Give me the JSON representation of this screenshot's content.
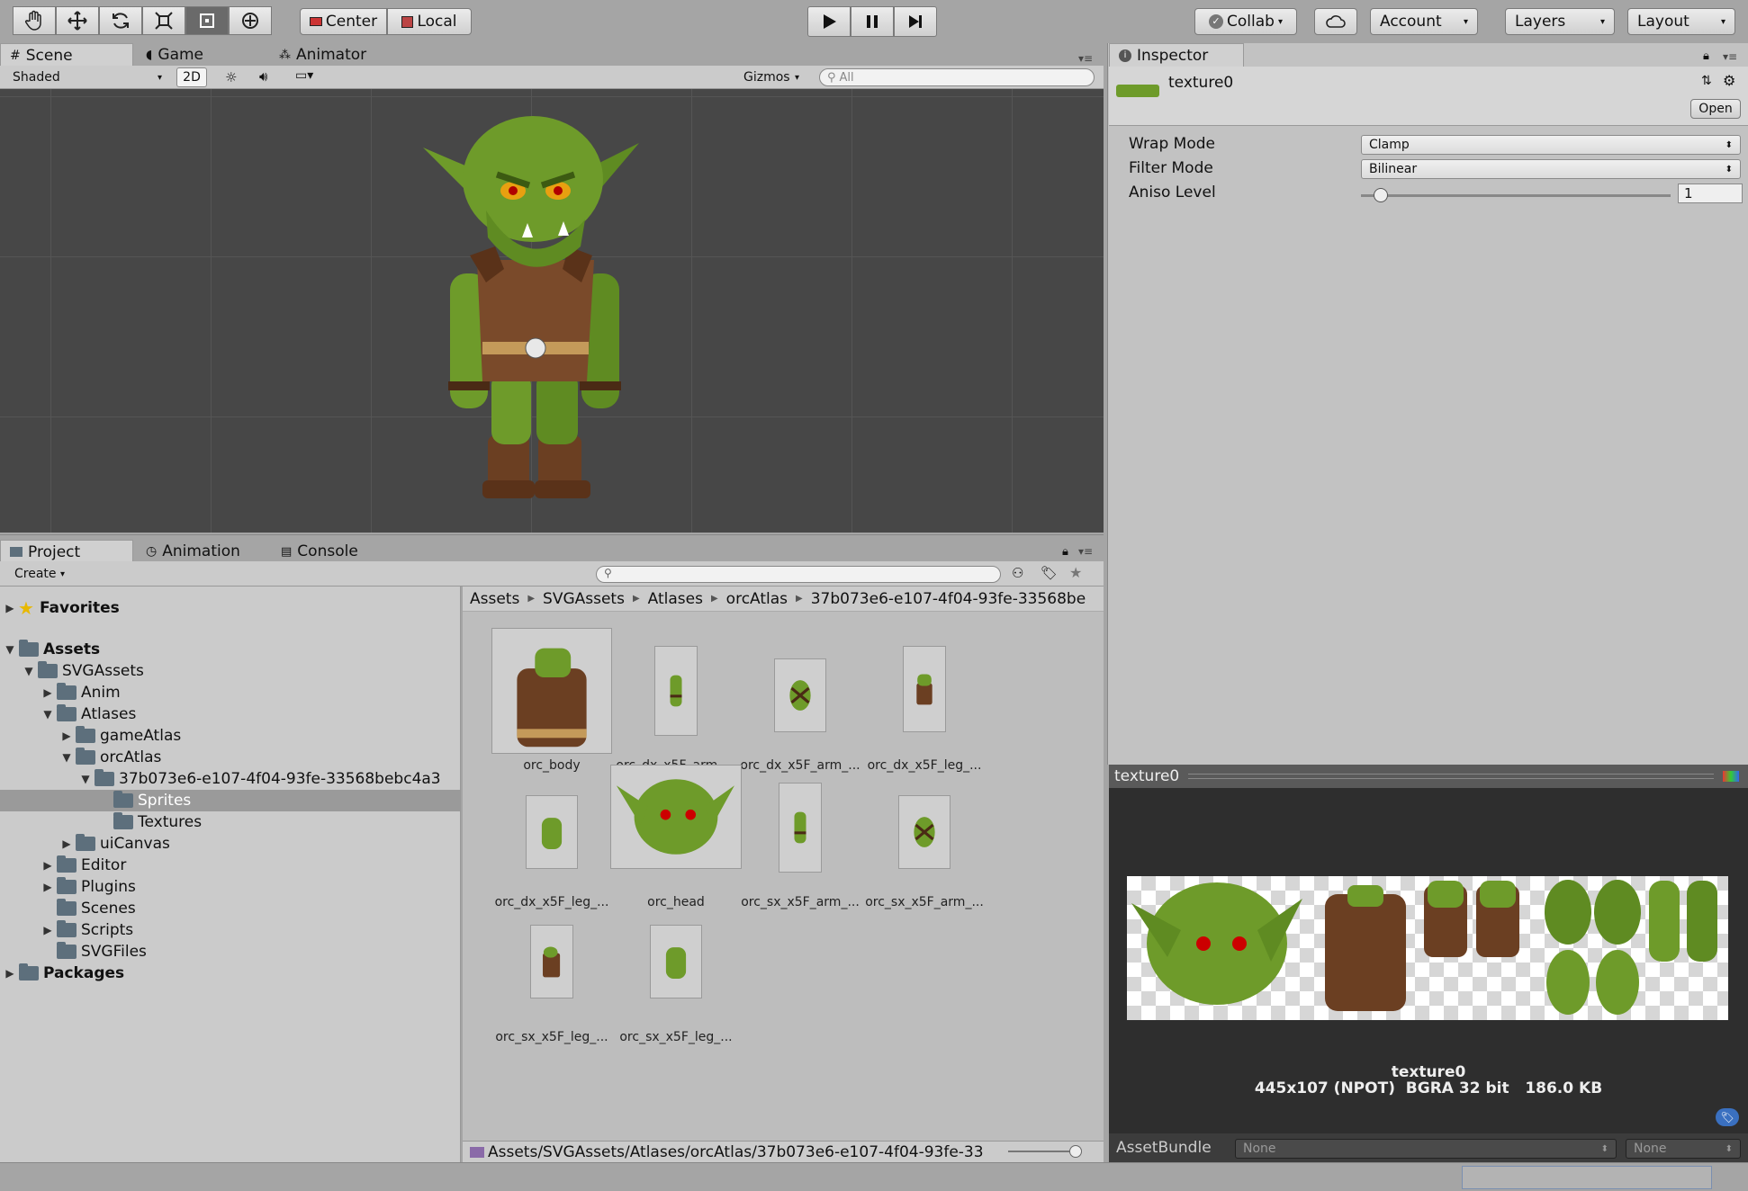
{
  "toolbar": {
    "tools": [
      "hand-icon",
      "move-icon",
      "rotate-icon",
      "scale-icon",
      "rect-icon",
      "transform-icon"
    ],
    "pivot": "Center",
    "space": "Local",
    "collab": "Collab",
    "account": "Account",
    "layers": "Layers",
    "layout": "Layout"
  },
  "scene": {
    "tabs": [
      "Scene",
      "Game",
      "Animator"
    ],
    "shading": "Shaded",
    "mode_2d": "2D",
    "gizmos": "Gizmos",
    "search_placeholder": "All"
  },
  "inspector": {
    "tab": "Inspector",
    "asset_name": "texture0",
    "open_button": "Open",
    "fields": [
      {
        "label": "Wrap Mode",
        "value": "Clamp"
      },
      {
        "label": "Filter Mode",
        "value": "Bilinear"
      },
      {
        "label": "Aniso Level",
        "value": "1"
      }
    ],
    "aniso_slider_fraction": 0.0
  },
  "preview": {
    "title": "texture0",
    "name": "texture0",
    "info": "445x107 (NPOT)  BGRA 32 bit   186.0 KB",
    "assetbundle_label": "AssetBundle",
    "assetbundle_value": "None",
    "assetbundle_variant": "None"
  },
  "project": {
    "tabs": [
      "Project",
      "Animation",
      "Console"
    ],
    "create": "Create",
    "tree": [
      {
        "label": "Favorites",
        "bold": true,
        "depth": 0,
        "arrow": "▶",
        "icon": "star"
      },
      {
        "label": "Assets",
        "bold": true,
        "depth": 0,
        "arrow": "▼",
        "icon": "folder"
      },
      {
        "label": "SVGAssets",
        "depth": 1,
        "arrow": "▼",
        "icon": "folder"
      },
      {
        "label": "Anim",
        "depth": 2,
        "arrow": "▶",
        "icon": "folder"
      },
      {
        "label": "Atlases",
        "depth": 2,
        "arrow": "▼",
        "icon": "folder"
      },
      {
        "label": "gameAtlas",
        "depth": 3,
        "arrow": "▶",
        "icon": "folder"
      },
      {
        "label": "orcAtlas",
        "depth": 3,
        "arrow": "▼",
        "icon": "folder"
      },
      {
        "label": "37b073e6-e107-4f04-93fe-33568bebc4a3",
        "depth": 4,
        "arrow": "▼",
        "icon": "folder"
      },
      {
        "label": "Sprites",
        "depth": 5,
        "arrow": "",
        "icon": "folder",
        "selected": true
      },
      {
        "label": "Textures",
        "depth": 5,
        "arrow": "",
        "icon": "folder"
      },
      {
        "label": "uiCanvas",
        "depth": 3,
        "arrow": "▶",
        "icon": "folder"
      },
      {
        "label": "Editor",
        "depth": 2,
        "arrow": "▶",
        "icon": "folder"
      },
      {
        "label": "Plugins",
        "depth": 2,
        "arrow": "▶",
        "icon": "folder"
      },
      {
        "label": "Scenes",
        "depth": 2,
        "arrow": "",
        "icon": "folder"
      },
      {
        "label": "Scripts",
        "depth": 2,
        "arrow": "▶",
        "icon": "folder"
      },
      {
        "label": "SVGFiles",
        "depth": 2,
        "arrow": "",
        "icon": "folder"
      },
      {
        "label": "Packages",
        "bold": true,
        "depth": 0,
        "arrow": "▶",
        "icon": "folder"
      }
    ],
    "breadcrumb": [
      "Assets",
      "SVGAssets",
      "Atlases",
      "orcAtlas",
      "37b073e6-e107-4f04-93fe-33568be"
    ],
    "assets": [
      {
        "name": "orc_body",
        "kind": "body"
      },
      {
        "name": "orc_dx_x5F_arm_...",
        "kind": "arm"
      },
      {
        "name": "orc_dx_x5F_arm_...",
        "kind": "arm2"
      },
      {
        "name": "orc_dx_x5F_leg_...",
        "kind": "leg"
      },
      {
        "name": "orc_dx_x5F_leg_...",
        "kind": "thigh"
      },
      {
        "name": "orc_head",
        "kind": "head"
      },
      {
        "name": "orc_sx_x5F_arm_...",
        "kind": "arm"
      },
      {
        "name": "orc_sx_x5F_arm_...",
        "kind": "arm2"
      },
      {
        "name": "orc_sx_x5F_leg_...",
        "kind": "boot"
      },
      {
        "name": "orc_sx_x5F_leg_...",
        "kind": "thigh"
      }
    ],
    "path": "Assets/SVGAssets/Atlases/orcAtlas/37b073e6-e107-4f04-93fe-33"
  },
  "colors": {
    "scene_bg": "#474747",
    "orc_green": "#6e9b2a",
    "orc_brown": "#6b3f22",
    "selection": "#9a9a9a"
  }
}
